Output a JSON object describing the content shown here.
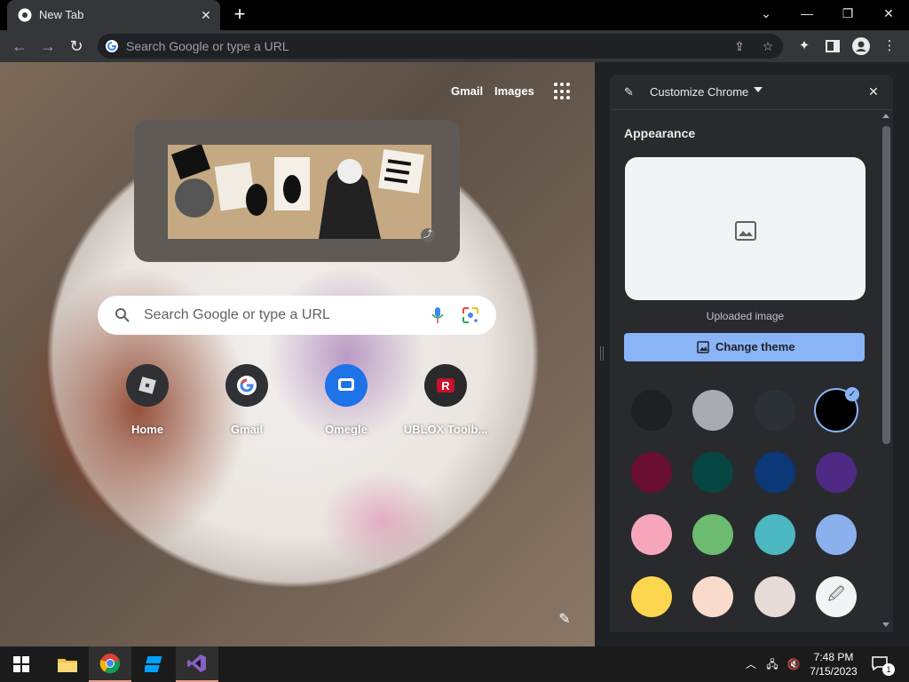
{
  "tab": {
    "title": "New Tab",
    "close_glyph": "✕"
  },
  "window_controls": {
    "dropdown_glyph": "⌄",
    "minimize_glyph": "—",
    "restore_glyph": "❐",
    "close_glyph": "✕"
  },
  "new_tab_glyph": "+",
  "omnibox": {
    "placeholder": "Search Google or type a URL"
  },
  "ntp": {
    "links": {
      "gmail": "Gmail",
      "images": "Images"
    },
    "search_placeholder": "Search Google or type a URL",
    "shortcuts": [
      {
        "label": "Home"
      },
      {
        "label": "Gmail"
      },
      {
        "label": "Omegle"
      },
      {
        "label": "UBLOX Toolb..."
      }
    ]
  },
  "side_panel": {
    "title": "Customize Chrome",
    "section_title": "Appearance",
    "preview_caption": "Uploaded image",
    "change_theme_label": "Change theme",
    "swatches": [
      {
        "name": "swatch-dark-gray",
        "color": "#1f2023",
        "selected": false
      },
      {
        "name": "swatch-light-gray",
        "color": "#a9abb1",
        "selected": false
      },
      {
        "name": "swatch-slate",
        "color": "#2b3137",
        "selected": false
      },
      {
        "name": "swatch-black",
        "color": "#000000",
        "selected": true
      },
      {
        "name": "swatch-maroon",
        "color": "#6a0f32",
        "selected": false
      },
      {
        "name": "swatch-dark-teal",
        "color": "#064642",
        "selected": false
      },
      {
        "name": "swatch-navy",
        "color": "#0b3877",
        "selected": false
      },
      {
        "name": "swatch-purple",
        "color": "#4e2a84",
        "selected": false
      },
      {
        "name": "swatch-pink",
        "color": "#f5a6bb",
        "selected": false
      },
      {
        "name": "swatch-green",
        "color": "#6dbb70",
        "selected": false
      },
      {
        "name": "swatch-teal",
        "color": "#4cb8c1",
        "selected": false
      },
      {
        "name": "swatch-light-blue",
        "color": "#8ab0ee",
        "selected": false
      },
      {
        "name": "swatch-yellow",
        "color": "#fbd64e",
        "selected": false
      },
      {
        "name": "swatch-peach",
        "color": "#f9dbcb",
        "selected": false
      },
      {
        "name": "swatch-beige",
        "color": "#e6dbd6",
        "selected": false
      },
      {
        "name": "swatch-custom",
        "color": "#f1f3f4",
        "selected": false
      }
    ],
    "check_glyph": "✓"
  },
  "taskbar": {
    "time": "7:48 PM",
    "date": "7/15/2023",
    "notifications_count": "1"
  },
  "colors": {
    "accent": "#8ab4f8",
    "panel_bg": "#292a2d",
    "toolbar_bg": "#35363a"
  }
}
